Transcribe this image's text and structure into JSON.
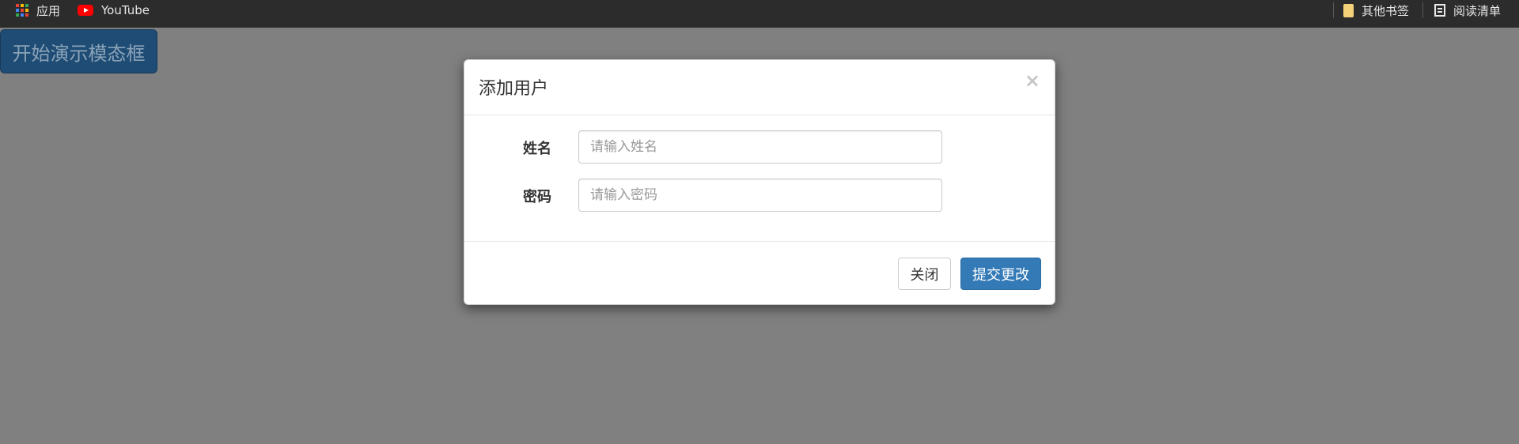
{
  "bookmarks_bar": {
    "items": [
      {
        "label": "应用",
        "icon": "apps-grid-icon"
      },
      {
        "label": "YouTube",
        "icon": "youtube-icon"
      }
    ],
    "right_items": [
      {
        "label": "其他书签",
        "icon": "folder-icon"
      },
      {
        "label": "阅读清单",
        "icon": "reading-list-icon"
      }
    ]
  },
  "page": {
    "launch_button_label": "开始演示模态框"
  },
  "modal": {
    "title": "添加用户",
    "close_symbol": "×",
    "fields": [
      {
        "label": "姓名",
        "placeholder": "请输入姓名",
        "value": ""
      },
      {
        "label": "密码",
        "placeholder": "请输入密码",
        "value": ""
      }
    ],
    "footer": {
      "close_label": "关闭",
      "submit_label": "提交更改"
    }
  },
  "colors": {
    "overlay": "#808080",
    "primary": "#337ab7",
    "bookmarks_bar_bg": "#2c2c2c"
  }
}
